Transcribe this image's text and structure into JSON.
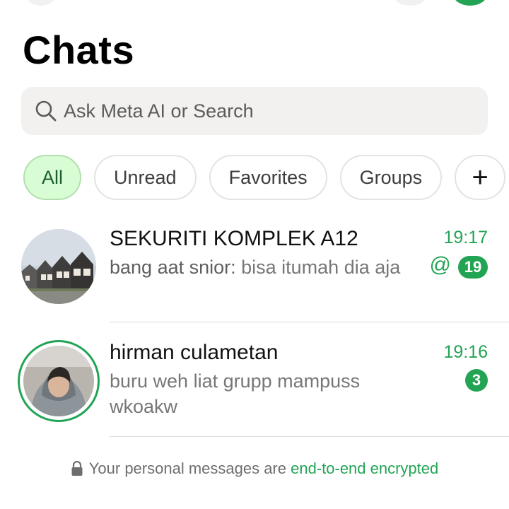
{
  "header": {
    "title": "Chats"
  },
  "search": {
    "placeholder": "Ask Meta AI or Search"
  },
  "filters": [
    {
      "label": "All",
      "active": true
    },
    {
      "label": "Unread",
      "active": false
    },
    {
      "label": "Favorites",
      "active": false
    },
    {
      "label": "Groups",
      "active": false
    },
    {
      "label": "+",
      "active": false
    }
  ],
  "chats": [
    {
      "name": "SEKURITI KOMPLEK A12",
      "sender": "bang aat snior:",
      "message": " bisa itumah dia aja",
      "time": "19:17",
      "mention": "@",
      "unread": "19",
      "avatar_icon": "house-row-photo"
    },
    {
      "name": "hirman culametan",
      "message": "buru weh liat grupp mampuss wkoakw",
      "time": "19:16",
      "unread": "3",
      "avatar_icon": "person-hoodie-photo",
      "has_status_ring": true
    }
  ],
  "footer": {
    "text": "Your personal messages are ",
    "link": "end-to-end encrypted"
  },
  "colors": {
    "accent": "#23a455",
    "active_chip_bg": "#d8fcd3",
    "search_bg": "#f2f1f0"
  }
}
